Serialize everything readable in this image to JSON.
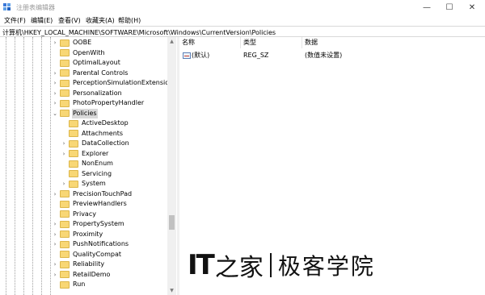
{
  "window": {
    "title": "注册表编辑器",
    "minimize": "—",
    "maximize": "☐",
    "close": "✕"
  },
  "menu": [
    "文件(F)",
    "编辑(E)",
    "查看(V)",
    "收藏夹(A)",
    "帮助(H)"
  ],
  "address": "计算机\\HKEY_LOCAL_MACHINE\\SOFTWARE\\Microsoft\\Windows\\CurrentVersion\\Policies",
  "tree": [
    {
      "label": "OOBE",
      "expander": "›",
      "selected": false
    },
    {
      "label": "OpenWith",
      "expander": "",
      "selected": false
    },
    {
      "label": "OptimalLayout",
      "expander": "",
      "selected": false
    },
    {
      "label": "Parental Controls",
      "expander": "›",
      "selected": false
    },
    {
      "label": "PerceptionSimulationExtensions",
      "expander": "›",
      "selected": false
    },
    {
      "label": "Personalization",
      "expander": "›",
      "selected": false
    },
    {
      "label": "PhotoPropertyHandler",
      "expander": "›",
      "selected": false
    },
    {
      "label": "Policies",
      "expander": "⌄",
      "selected": true
    },
    {
      "label": "ActiveDesktop",
      "expander": "",
      "selected": false
    },
    {
      "label": "Attachments",
      "expander": "",
      "selected": false
    },
    {
      "label": "DataCollection",
      "expander": "›",
      "selected": false
    },
    {
      "label": "Explorer",
      "expander": "›",
      "selected": false
    },
    {
      "label": "NonEnum",
      "expander": "",
      "selected": false
    },
    {
      "label": "Servicing",
      "expander": "",
      "selected": false
    },
    {
      "label": "System",
      "expander": "›",
      "selected": false
    },
    {
      "label": "PrecisionTouchPad",
      "expander": "›",
      "selected": false
    },
    {
      "label": "PreviewHandlers",
      "expander": "",
      "selected": false
    },
    {
      "label": "Privacy",
      "expander": "",
      "selected": false
    },
    {
      "label": "PropertySystem",
      "expander": "›",
      "selected": false
    },
    {
      "label": "Proximity",
      "expander": "›",
      "selected": false
    },
    {
      "label": "PushNotifications",
      "expander": "›",
      "selected": false
    },
    {
      "label": "QualityCompat",
      "expander": "",
      "selected": false
    },
    {
      "label": "Reliability",
      "expander": "›",
      "selected": false
    },
    {
      "label": "RetailDemo",
      "expander": "›",
      "selected": false
    },
    {
      "label": "Run",
      "expander": "",
      "selected": false
    }
  ],
  "scrollbar": {
    "up": "▲",
    "down": "▼"
  },
  "columns": [
    "名称",
    "类型",
    "数据"
  ],
  "values": [
    {
      "name": "(默认)",
      "type": "REG_SZ",
      "data": "(数值未设置)"
    }
  ],
  "watermark": {
    "it": "IT",
    "glyph": "之家",
    "text": "极客学院"
  }
}
